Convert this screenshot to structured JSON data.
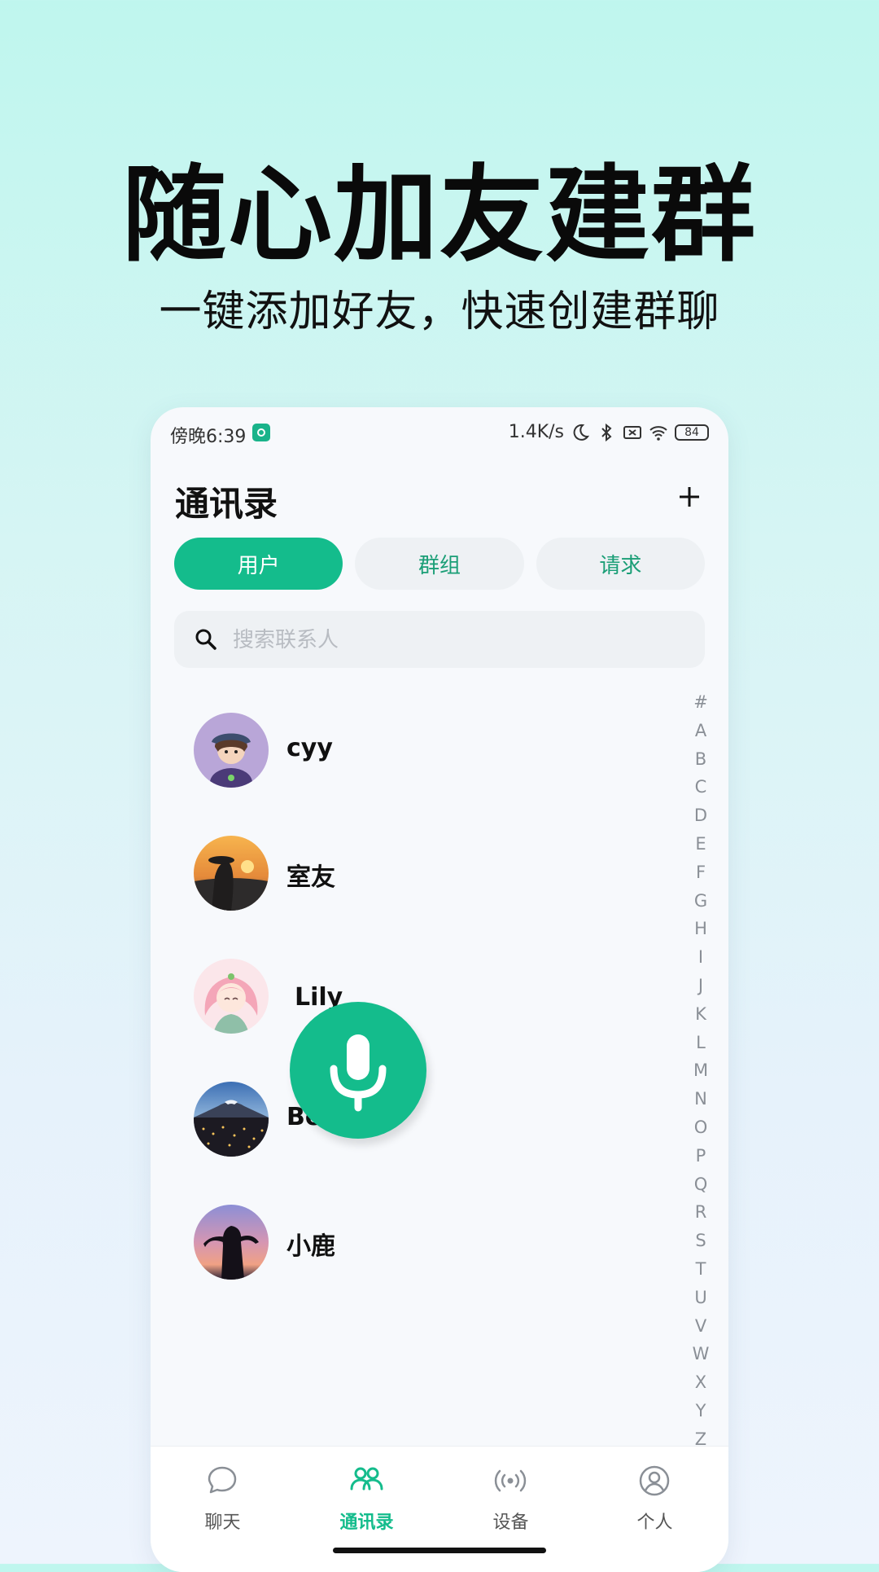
{
  "promo": {
    "headline": "随心加友建群",
    "subline": "一键添加好友，快速创建群聊"
  },
  "status_bar": {
    "time": "傍晚6:39",
    "speed": "1.4K/s",
    "battery": "84"
  },
  "header": {
    "title": "通讯录",
    "add_icon": "plus-icon"
  },
  "tabs": [
    {
      "label": "用户",
      "active": true
    },
    {
      "label": "群组",
      "active": false
    },
    {
      "label": "请求",
      "active": false
    }
  ],
  "search": {
    "placeholder": "搜索联系人",
    "value": ""
  },
  "contacts": [
    {
      "name": "cyy"
    },
    {
      "name": "室友"
    },
    {
      "name": "Lily"
    },
    {
      "name": "Ben"
    },
    {
      "name": "小鹿"
    }
  ],
  "alphabet": [
    "#",
    "A",
    "B",
    "C",
    "D",
    "E",
    "F",
    "G",
    "H",
    "I",
    "J",
    "K",
    "L",
    "M",
    "N",
    "O",
    "P",
    "Q",
    "R",
    "S",
    "T",
    "U",
    "V",
    "W",
    "X",
    "Y",
    "Z"
  ],
  "nav": [
    {
      "label": "聊天",
      "icon": "chat-icon",
      "active": false
    },
    {
      "label": "通讯录",
      "icon": "contacts-icon",
      "active": true
    },
    {
      "label": "设备",
      "icon": "device-icon",
      "active": false
    },
    {
      "label": "个人",
      "icon": "profile-icon",
      "active": false
    }
  ],
  "colors": {
    "accent": "#14bc8c",
    "tab_inactive_text": "#1a9e76"
  }
}
